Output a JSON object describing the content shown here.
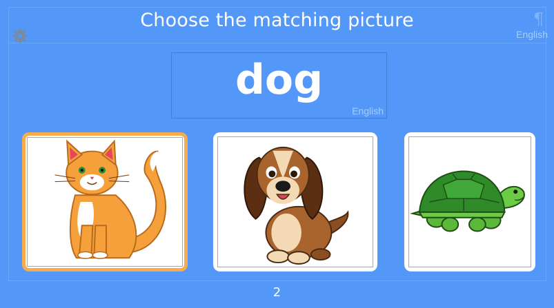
{
  "header": {
    "title": "Choose the matching picture",
    "language": "English",
    "settings_icon": "gear-icon",
    "paragraph_icon": "pilcrow-icon"
  },
  "prompt": {
    "word": "dog",
    "language": "English"
  },
  "choices": [
    {
      "name": "cat",
      "selected": true
    },
    {
      "name": "dog",
      "selected": false
    },
    {
      "name": "turtle",
      "selected": false
    }
  ],
  "footer": {
    "page_number": "2"
  },
  "colors": {
    "background": "#5398f8",
    "selected_border": "#f6ac4c"
  }
}
